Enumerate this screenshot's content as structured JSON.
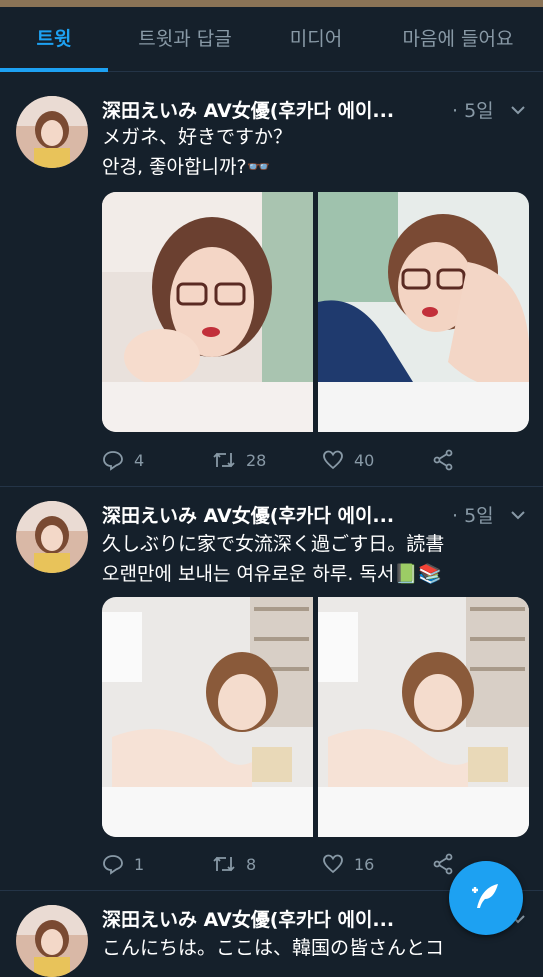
{
  "tabs": [
    {
      "label": "트윗",
      "active": true
    },
    {
      "label": "트윗과 답글",
      "active": false
    },
    {
      "label": "미디어",
      "active": false
    },
    {
      "label": "마음에 들어요",
      "active": false
    }
  ],
  "tweets": [
    {
      "display_name": "深田えいみ AV女優(후카다 에이...",
      "time": "· 5일",
      "text_lines": [
        "メガネ、好きですか？",
        "안경, 좋아합니까?👓"
      ],
      "replies": "4",
      "retweets": "28",
      "likes": "40"
    },
    {
      "display_name": "深田えいみ AV女優(후카다 에이...",
      "time": "· 5일",
      "text_lines": [
        "久しぶりに家で女流深く過ごす日。読書",
        "오랜만에 보내는 여유로운 하루. 독서📗📚"
      ],
      "replies": "1",
      "retweets": "8",
      "likes": "16"
    },
    {
      "display_name": "深田えいみ AV女優(후카다 에이...",
      "time": "",
      "text_lines": [
        "こんにちは。ここは、韓国の皆さんとコ"
      ]
    }
  ],
  "colors": {
    "background": "#15202b",
    "accent": "#1da1f2",
    "secondary_text": "#8899a6",
    "divider": "#243447"
  },
  "icons": {
    "reply": "reply-icon",
    "retweet": "retweet-icon",
    "like": "heart-icon",
    "share": "share-icon",
    "more": "chevron-down-icon",
    "compose": "compose-tweet-icon"
  }
}
